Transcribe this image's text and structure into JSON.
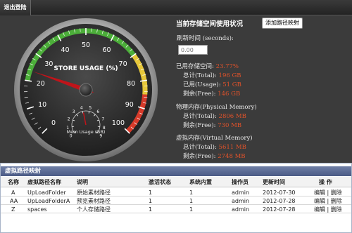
{
  "header": {
    "logout_label": "退出登陆"
  },
  "gauge": {
    "title": "STORE USAGE (%)",
    "value_percent": 23.77,
    "ticks": [
      "0",
      "10",
      "20",
      "30",
      "40",
      "50",
      "60",
      "70",
      "80",
      "90",
      "100"
    ],
    "sub_title": "Mem Usage (GB)",
    "sub_ticks": [
      "0",
      "1",
      "2",
      "3",
      "4",
      "5",
      "6",
      "7",
      "8",
      "9"
    ],
    "colors": {
      "green": "#4cae3a",
      "yellow": "#e6c73a",
      "red": "#d63a2a",
      "needle": "#c0141a"
    }
  },
  "info": {
    "title": "当前存储空间使用状况",
    "add_button": "添加路径映射",
    "refresh_label": "刷新时间 (seconds):",
    "refresh_value": "0.00",
    "storage_used_label": "已用存储空间:",
    "storage_used_value": "23.77%",
    "total_label": "总计(Total):",
    "total_value": "196 GB",
    "usage_label": "已用(Usage):",
    "usage_value": "51 GB",
    "free_label": "剩余(Free):",
    "free_value": "146 GB",
    "physical_title": "物理内存(Physical Memory)",
    "phys_total_label": "总计(Total):",
    "phys_total_value": "2806 MB",
    "phys_free_label": "剩余(Free):",
    "phys_free_value": "730 MB",
    "virtual_title": "虚拟内存(Virtual Memory)",
    "virt_total_label": "总计(Total):",
    "virt_total_value": "5611 MB",
    "virt_free_label": "剩余(Free):",
    "virt_free_value": "2748 MB"
  },
  "table": {
    "title": "虚拟路径映射",
    "columns": [
      "名称",
      "虚拟路径名称",
      "说明",
      "激活状态",
      "系统内置",
      "操作员",
      "更新时间",
      "操 作"
    ],
    "rows": [
      {
        "name": "A",
        "path": "UpLoadFolder",
        "desc": "原始素材路径",
        "active": "1",
        "builtin": "1",
        "operator": "admin",
        "updated": "2012-07-30",
        "edit": "编辑",
        "delete": "删除"
      },
      {
        "name": "AA",
        "path": "UpLoadFolderA",
        "desc": "预览素材路径",
        "active": "1",
        "builtin": "1",
        "operator": "admin",
        "updated": "2012-07-28",
        "edit": "编辑",
        "delete": "删除"
      },
      {
        "name": "Z",
        "path": "spaces",
        "desc": "个人存储路径",
        "active": "1",
        "builtin": "1",
        "operator": "admin",
        "updated": "2012-07-28",
        "edit": "编辑",
        "delete": "删除"
      }
    ]
  }
}
